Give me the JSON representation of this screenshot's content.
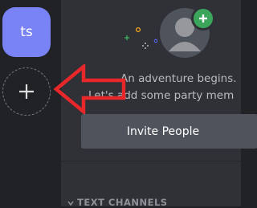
{
  "server_rail": {
    "server": {
      "initials": "ts",
      "color": "#7983f5"
    },
    "add_server_icon": "plus-icon"
  },
  "welcome": {
    "avatar_icon": "default-avatar-icon",
    "badge_icon": "plus-icon",
    "badge_color": "#3ba55c",
    "headline": "An adventure begins.",
    "subline": "Let's add some party mem",
    "invite_button_label": "Invite People"
  },
  "channels": {
    "section_header": "TEXT CHANNELS",
    "collapse_icon": "chevron-down-icon"
  },
  "annotation": {
    "arrow_icon": "red-arrow-left",
    "arrow_color": "#e8272b"
  }
}
